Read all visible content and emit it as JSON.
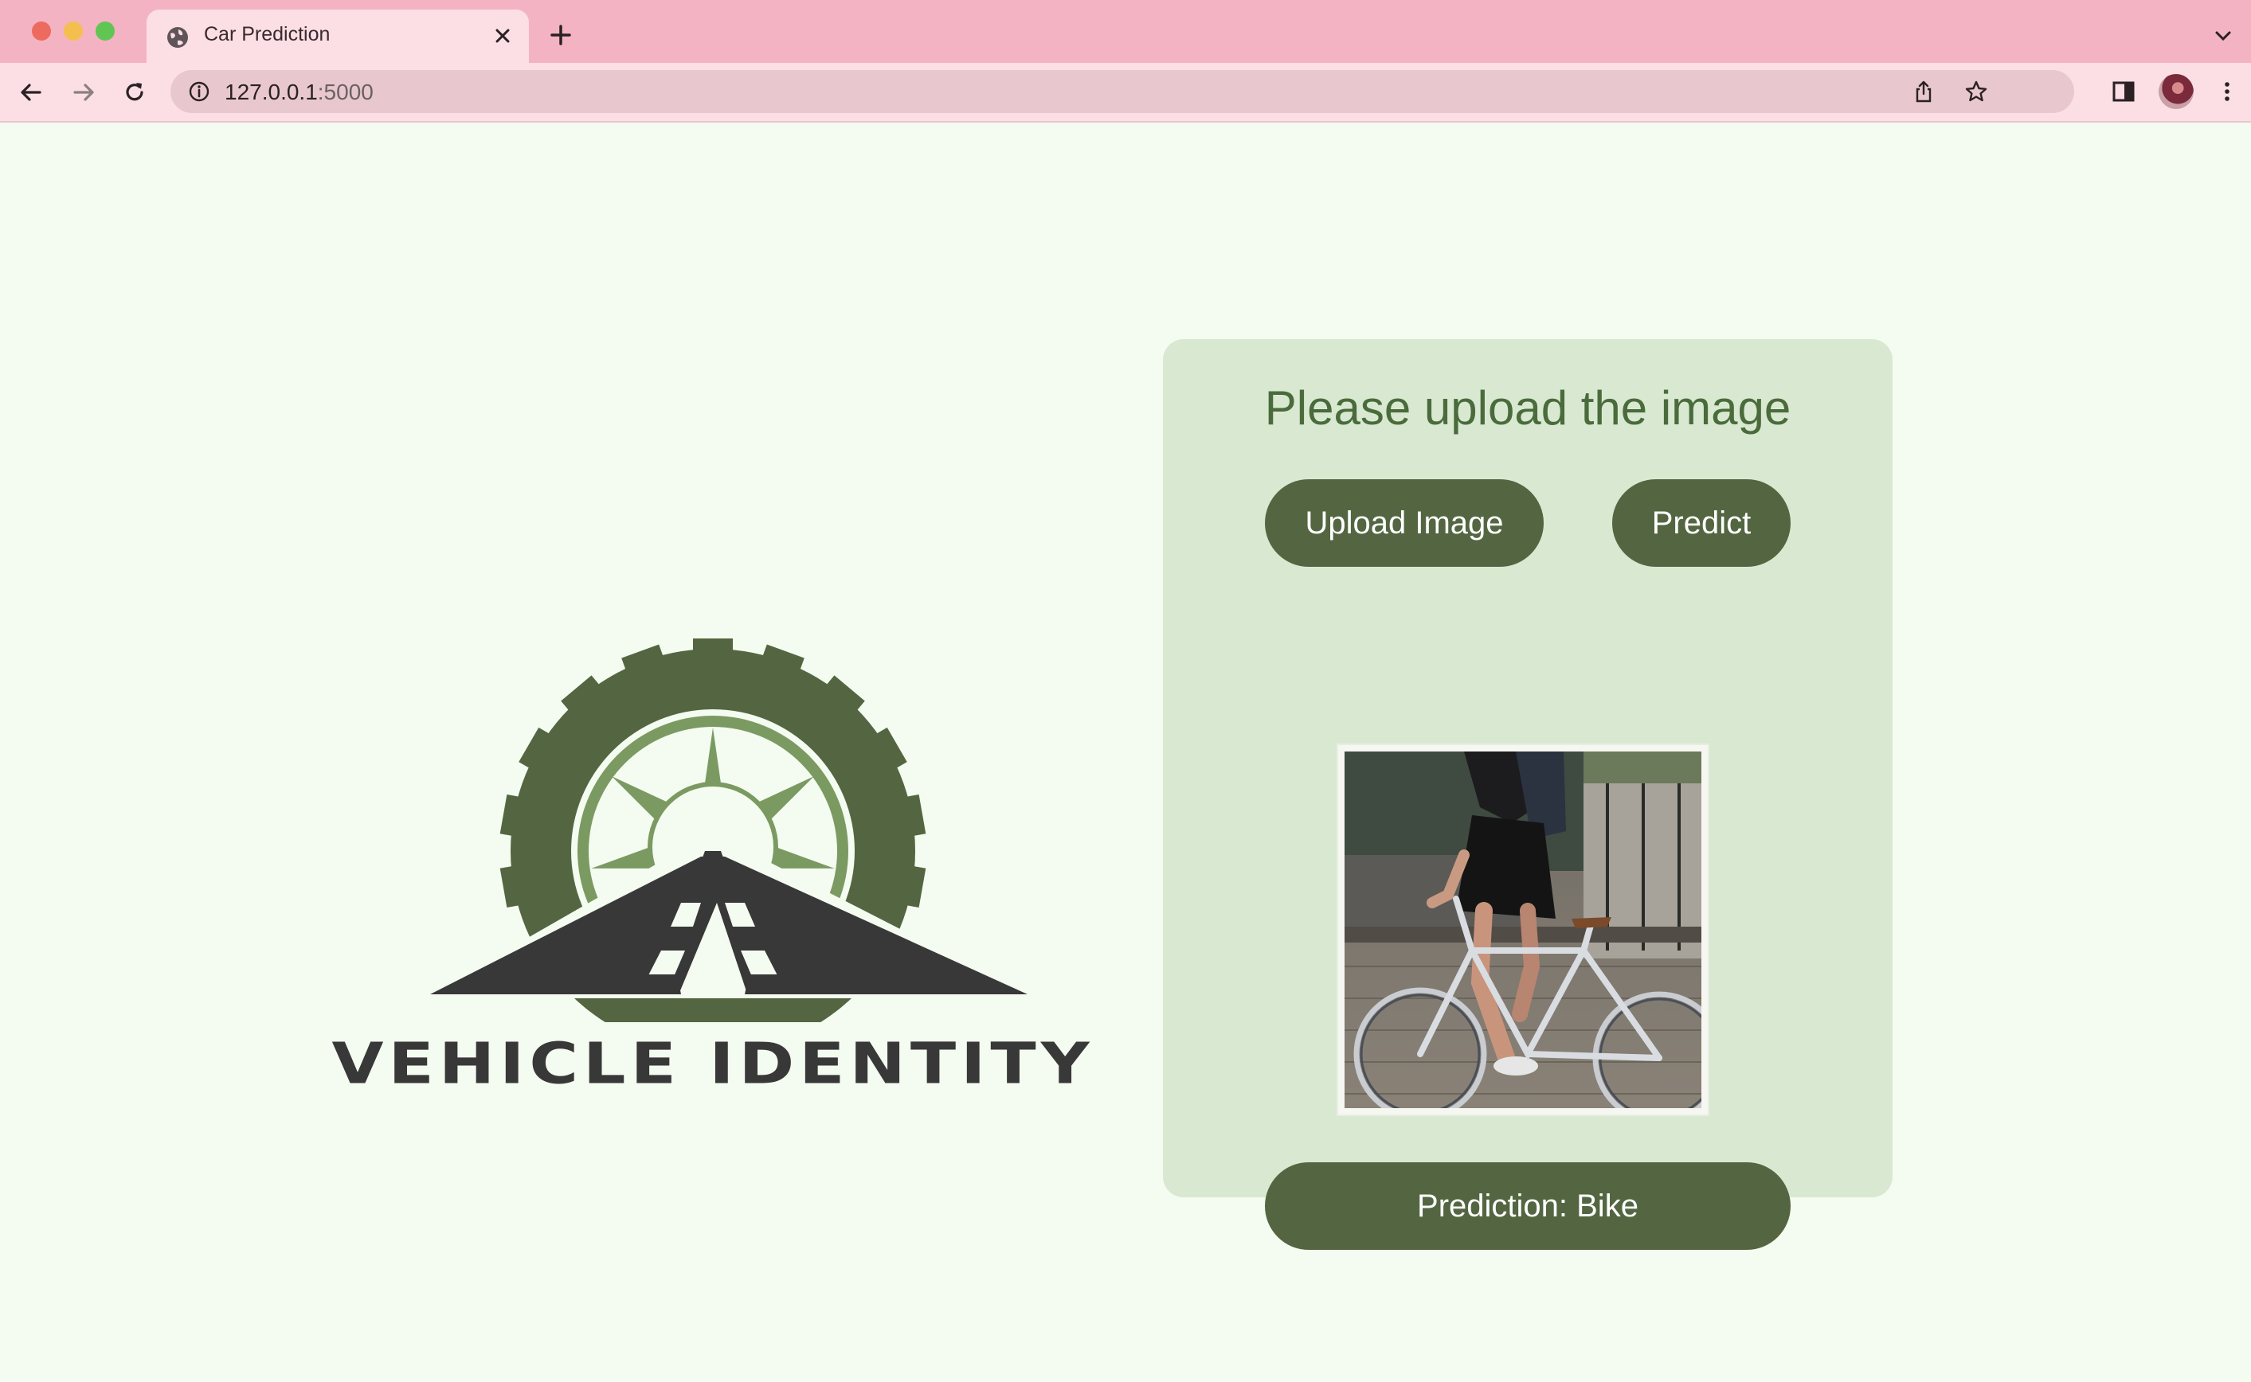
{
  "browser": {
    "tab_title": "Car Prediction",
    "url_host": "127.0.0.1",
    "url_port": ":5000"
  },
  "colors": {
    "accent": "#536641",
    "card_background": "#d9e9d1",
    "page_background": "#f4fbf0",
    "title_text": "#4a6b3c",
    "browser_frame": "#f4b3c2"
  },
  "logo": {
    "text": "VEHICLE IDENTITY",
    "icon": "wheel-road-logo"
  },
  "panel": {
    "title": "Please upload the image",
    "upload_label": "Upload Image",
    "predict_label": "Predict",
    "preview_image": "uploaded-bicycle-photo",
    "prediction_text": "Prediction: Bike"
  }
}
